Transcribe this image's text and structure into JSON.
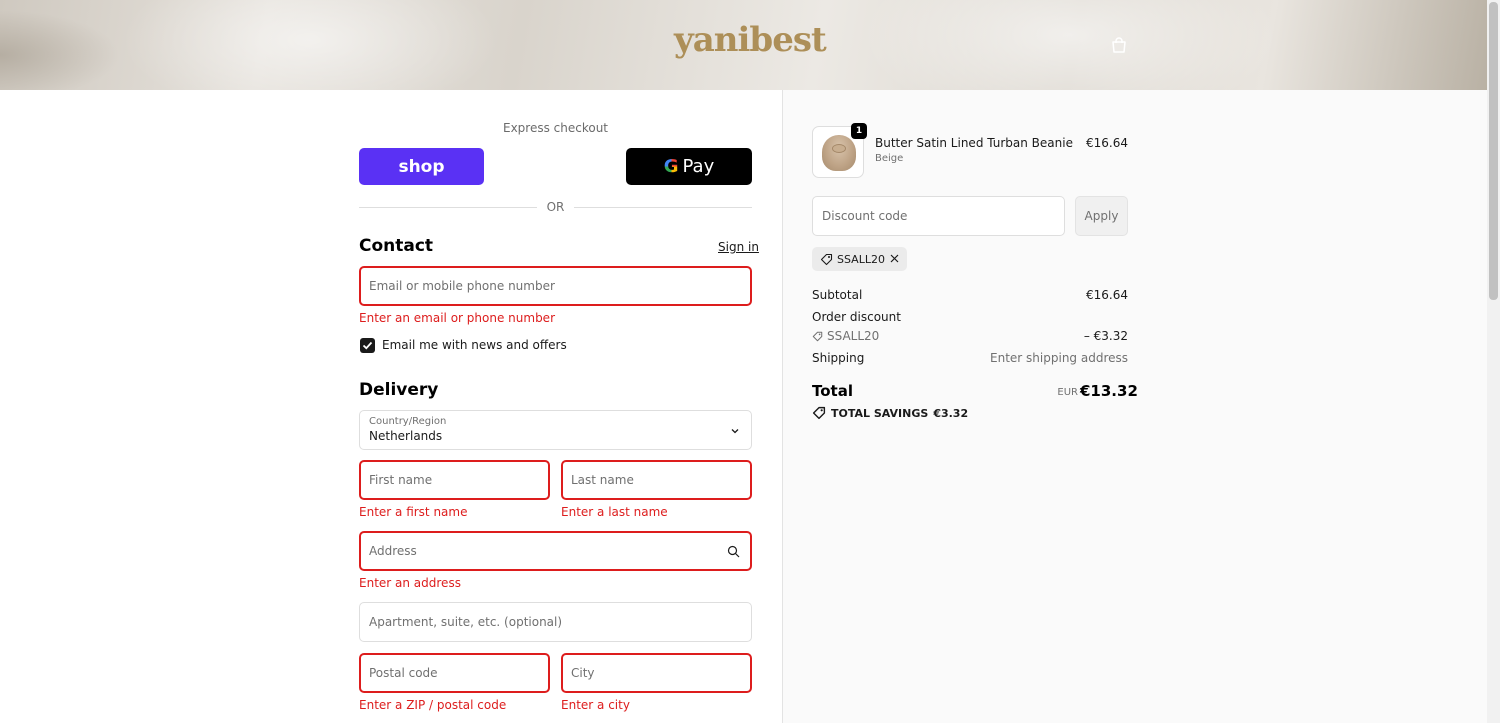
{
  "header": {
    "logo_text": "yanibest",
    "cart_icon": "shopping-bag-icon"
  },
  "express": {
    "label": "Express checkout",
    "shop_pay_label": "shop",
    "gpay_g": "G",
    "gpay_label": "Pay",
    "or_label": "OR"
  },
  "contact": {
    "title": "Contact",
    "sign_in_label": "Sign in",
    "email_placeholder": "Email or mobile phone number",
    "email_error": "Enter an email or phone number",
    "newsletter_label": "Email me with news and offers",
    "newsletter_checked": true
  },
  "delivery": {
    "title": "Delivery",
    "country_label": "Country/Region",
    "country_value": "Netherlands",
    "first_name_placeholder": "First name",
    "first_name_error": "Enter a first name",
    "last_name_placeholder": "Last name",
    "last_name_error": "Enter a last name",
    "address_placeholder": "Address",
    "address_error": "Enter an address",
    "apartment_placeholder": "Apartment, suite, etc. (optional)",
    "postal_placeholder": "Postal code",
    "postal_error": "Enter a ZIP / postal code",
    "city_placeholder": "City",
    "city_error": "Enter a city"
  },
  "order": {
    "product": {
      "name": "Butter Satin Lined Turban Beanie",
      "variant": "Beige",
      "price": "€16.64",
      "quantity": "1"
    },
    "discount_placeholder": "Discount code",
    "apply_label": "Apply",
    "applied_code": "SSALL20",
    "summary": {
      "subtotal_label": "Subtotal",
      "subtotal_value": "€16.64",
      "order_discount_label": "Order discount",
      "discount_code": "SSALL20",
      "discount_value": "– €3.32",
      "shipping_label": "Shipping",
      "shipping_value": "Enter shipping address",
      "total_label": "Total",
      "total_currency": "EUR",
      "total_value": "€13.32",
      "savings_label": "TOTAL SAVINGS",
      "savings_value": "€3.32"
    }
  },
  "colors": {
    "accent_shop": "#5a31f4",
    "error": "#dd1d1d",
    "logo": "#ad8f58"
  }
}
